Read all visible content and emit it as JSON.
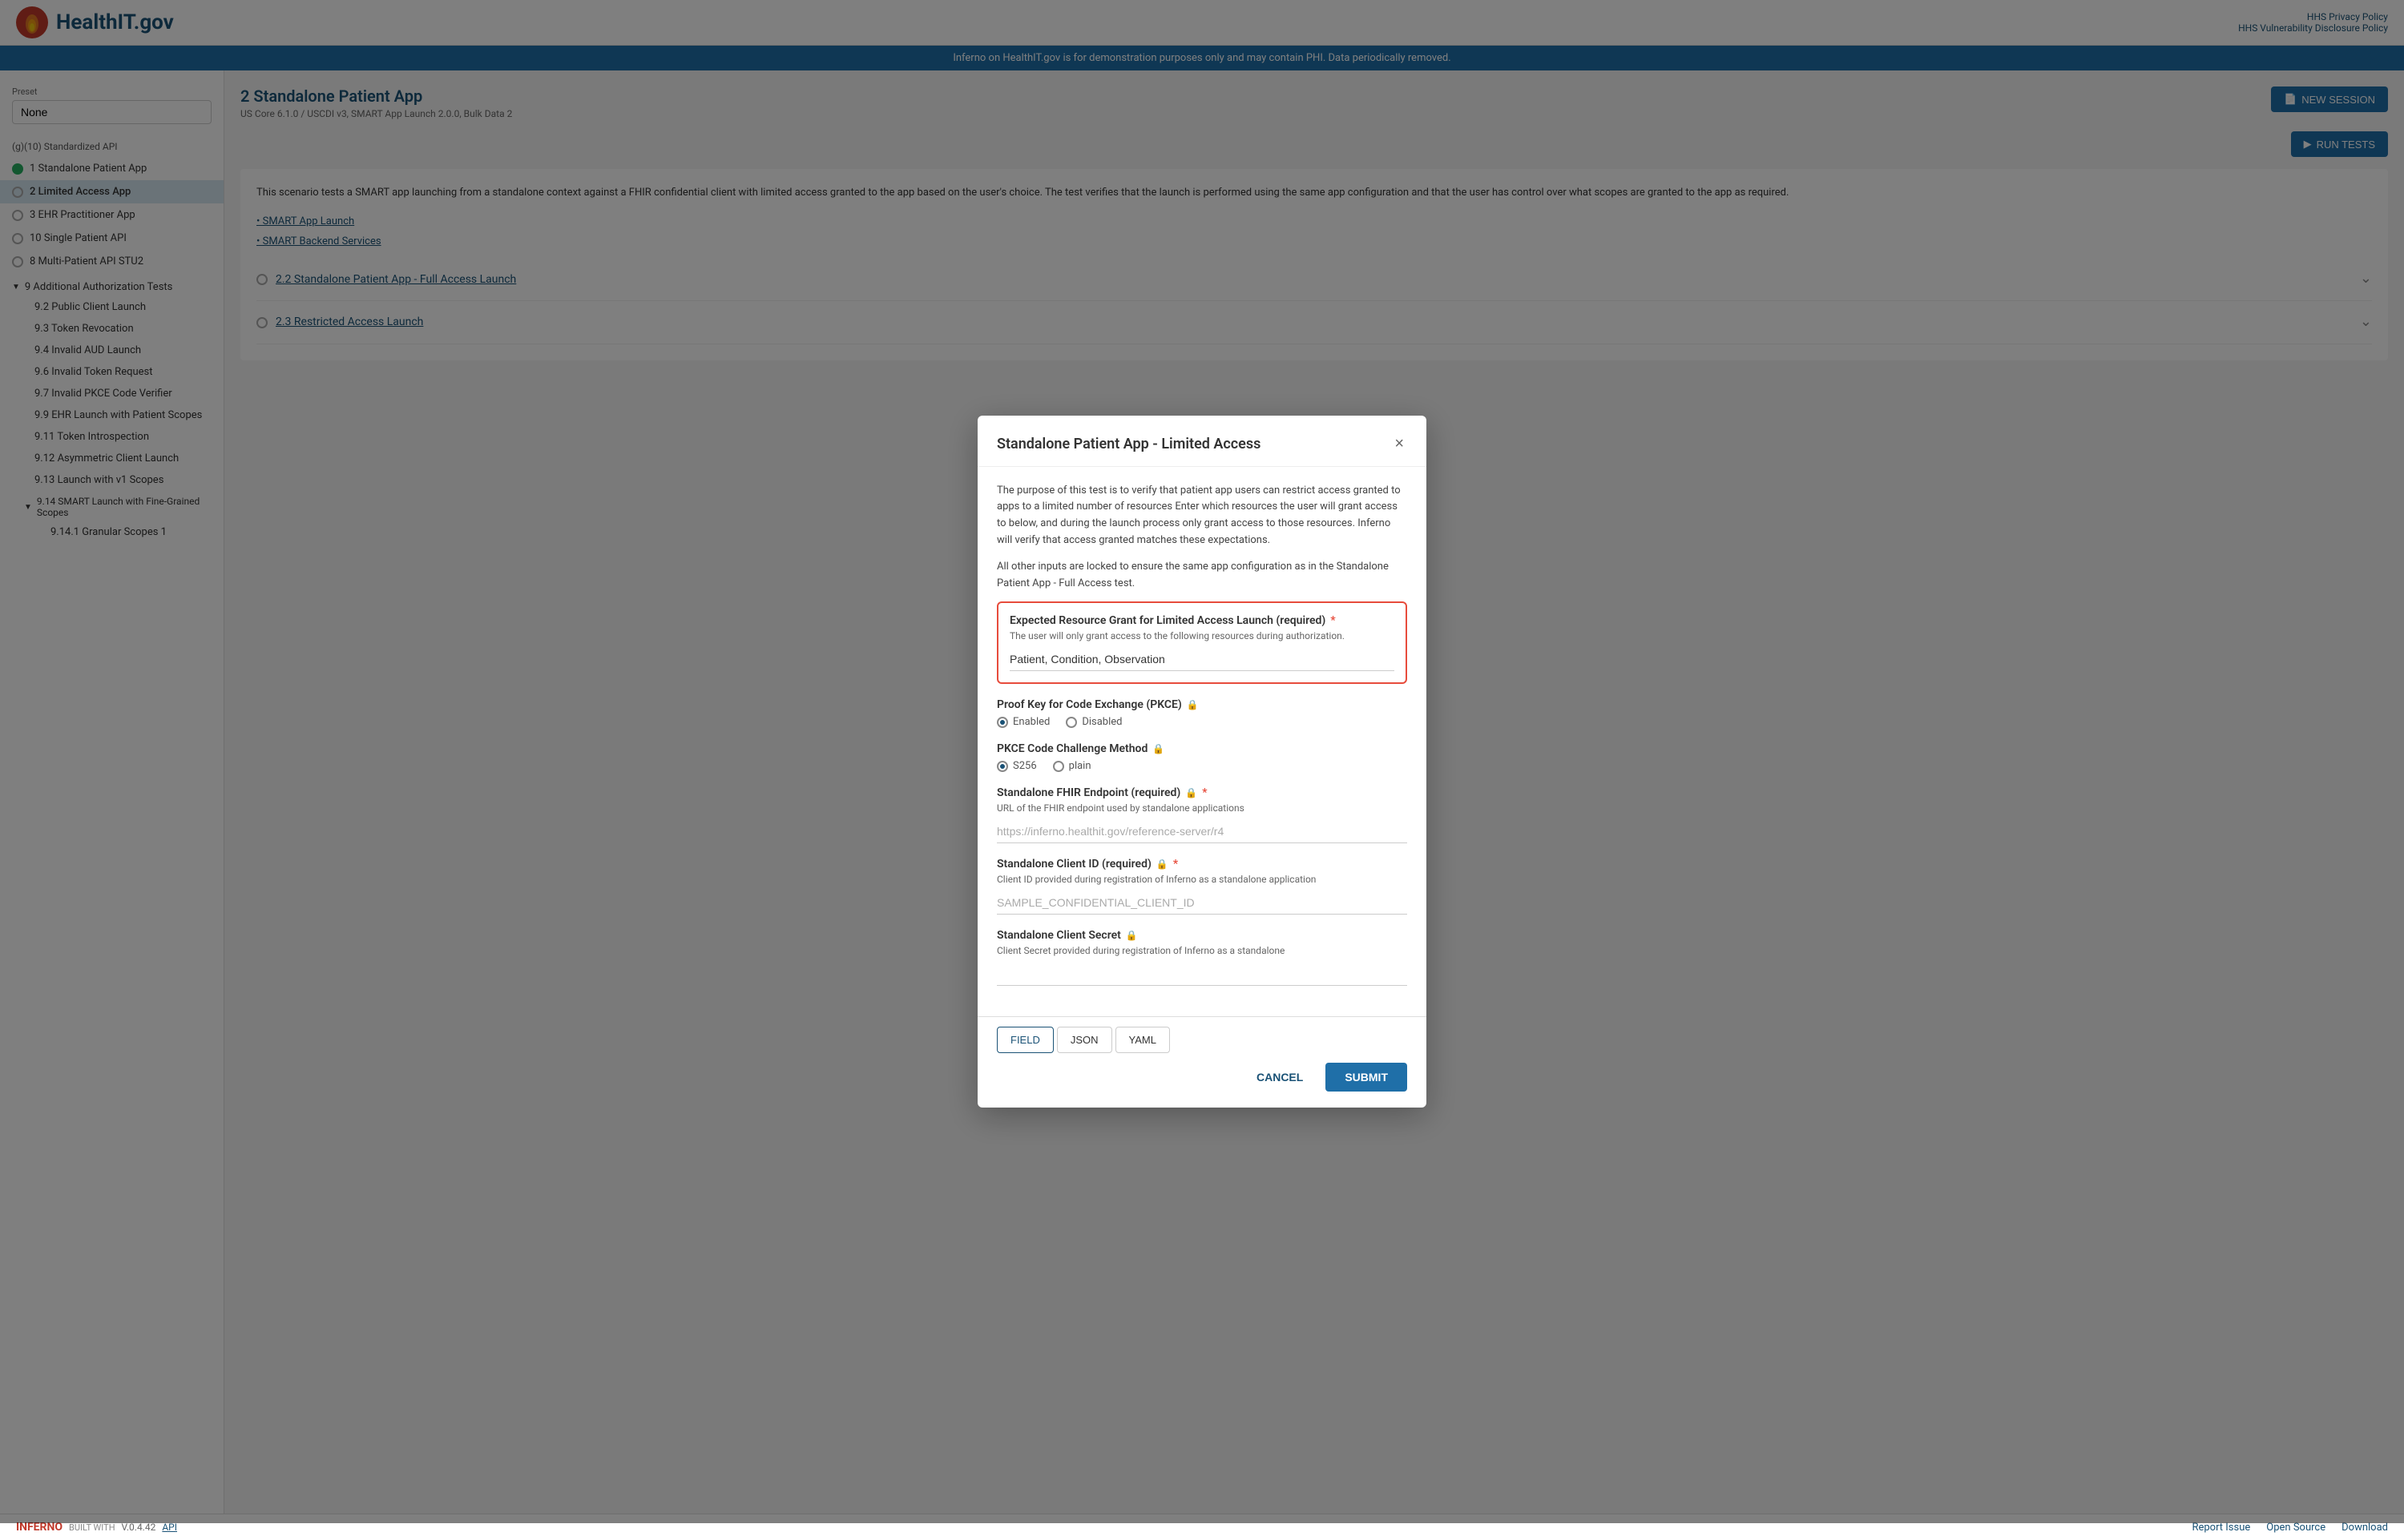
{
  "header": {
    "logo_text": "HealthIT.gov",
    "links": [
      "HHS Privacy Policy",
      "HHS Vulnerability Disclosure Policy"
    ]
  },
  "banner": {
    "text": "Inferno on HealthIT.gov is for demonstration purposes only and may contain PHI. Data periodically removed."
  },
  "sidebar": {
    "preset_label": "Preset",
    "preset_value": "None",
    "section_label": "(g)(10) Standardized API",
    "items": [
      {
        "id": "standalone-patient-app",
        "label": "1 Standalone Patient App",
        "status": "checked",
        "type": "main"
      },
      {
        "id": "limited-access-app",
        "label": "2 Limited Access App",
        "status": "empty",
        "type": "main",
        "active": true
      },
      {
        "id": "ehr-practitioner-app",
        "label": "3 EHR Practitioner App",
        "status": "empty",
        "type": "main"
      },
      {
        "id": "single-patient-api",
        "label": "10 Single Patient API",
        "status": "empty",
        "type": "main"
      },
      {
        "id": "multi-patient-api",
        "label": "8 Multi-Patient API STU2",
        "status": "empty",
        "type": "main"
      }
    ],
    "group": {
      "label": "9 Additional Authorization Tests",
      "expanded": true,
      "sub_items": [
        {
          "id": "public-client-launch",
          "label": "9.2 Public Client Launch"
        },
        {
          "id": "token-revocation",
          "label": "9.3 Token Revocation"
        },
        {
          "id": "invalid-aud-launch",
          "label": "9.4 Invalid AUD Launch"
        },
        {
          "id": "invalid-token-request",
          "label": "9.6 Invalid Token Request"
        },
        {
          "id": "invalid-pkce-code-verifier",
          "label": "9.7 Invalid PKCE Code Verifier"
        },
        {
          "id": "ehr-launch-patient-scopes",
          "label": "9.9 EHR Launch with Patient Scopes"
        },
        {
          "id": "token-introspection",
          "label": "9.11 Token Introspection"
        },
        {
          "id": "asymmetric-client-launch",
          "label": "9.12 Asymmetric Client Launch"
        },
        {
          "id": "launch-v1-scopes",
          "label": "9.13 Launch with v1 Scopes"
        }
      ],
      "sub_group": {
        "label": "9.14 SMART Launch with Fine-Grained Scopes",
        "items": [
          {
            "id": "granular-scopes-1",
            "label": "9.14.1 Granular Scopes 1"
          }
        ]
      }
    }
  },
  "content": {
    "title": "2 Standalone Patient App",
    "subtitle": "US Core 6.1.0 / USCDI v3, SMART App Launch 2.0.0, Bulk Data 2",
    "btn_new_session": "NEW SESSION",
    "btn_run_tests": "RUN TESTS",
    "body_text": "This scenario tests a SMART app launching from a standalone context against a FHIR confidential client with limited access granted to the app based on the user's choice. The test verifies that the launch is performed using the same app configuration and that the user has control over what scopes are granted to the app as required.",
    "test_rows": [
      {
        "label": "2.2 Standalone Patient App - Full Access Launch"
      },
      {
        "label": "2.3 Restricted Access Launch"
      }
    ],
    "links": [
      "SMART App Launch",
      "SMART Backend Services"
    ]
  },
  "modal": {
    "title": "Standalone Patient App - Limited Access",
    "close_label": "×",
    "description_1": "The purpose of this test is to verify that patient app users can restrict access granted to apps to a limited number of resources Enter which resources the user will grant access to below, and during the launch process only grant access to those resources. Inferno will verify that access granted matches these expectations.",
    "description_2": "All other inputs are locked to ensure the same app configuration as in the Standalone Patient App - Full Access test.",
    "fields": [
      {
        "id": "expected-resource-grant",
        "label": "Expected Resource Grant for Limited Access Launch (required)",
        "required": true,
        "locked": false,
        "highlighted": true,
        "desc": "The user will only grant access to the following resources during authorization.",
        "value": "Patient, Condition, Observation",
        "placeholder": ""
      },
      {
        "id": "pkce",
        "label": "Proof Key for Code Exchange (PKCE)",
        "locked": true,
        "type": "radio",
        "options": [
          "Enabled",
          "Disabled"
        ],
        "selected": "Enabled"
      },
      {
        "id": "pkce-code-challenge-method",
        "label": "PKCE Code Challenge Method",
        "locked": true,
        "type": "radio",
        "options": [
          "S256",
          "plain"
        ],
        "selected": "S256"
      },
      {
        "id": "standalone-fhir-endpoint",
        "label": "Standalone FHIR Endpoint (required)",
        "required": true,
        "locked": true,
        "desc": "URL of the FHIR endpoint used by standalone applications",
        "placeholder": "https://inferno.healthit.gov/reference-server/r4",
        "value": ""
      },
      {
        "id": "standalone-client-id",
        "label": "Standalone Client ID (required)",
        "required": true,
        "locked": true,
        "desc": "Client ID provided during registration of Inferno as a standalone application",
        "placeholder": "SAMPLE_CONFIDENTIAL_CLIENT_ID",
        "value": ""
      },
      {
        "id": "standalone-client-secret",
        "label": "Standalone Client Secret",
        "locked": true,
        "desc": "Client Secret provided during registration of Inferno as a standalone",
        "placeholder": "",
        "value": ""
      }
    ],
    "tabs": [
      "FIELD",
      "JSON",
      "YAML"
    ],
    "active_tab": "FIELD",
    "btn_cancel": "CANCEL",
    "btn_submit": "SUBMIT"
  },
  "footer": {
    "version": "V.0.4.42",
    "api_label": "API",
    "built_with": "BUILT WITH",
    "links": [
      "Report Issue",
      "Open Source",
      "Download"
    ]
  }
}
